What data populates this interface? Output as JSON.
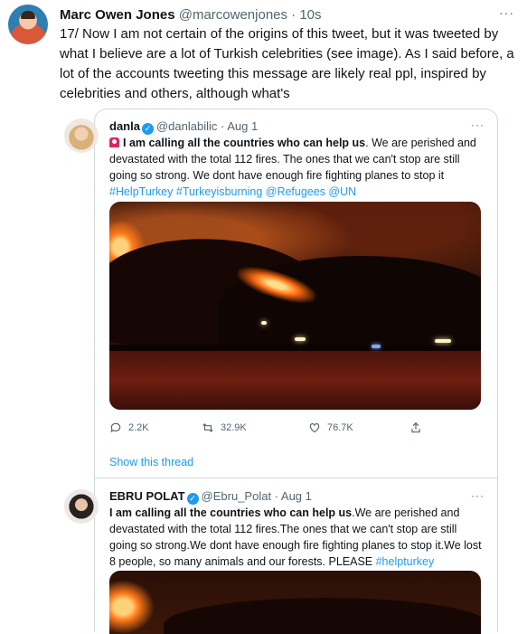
{
  "main_tweet": {
    "name": "Marc Owen Jones",
    "meta": "@marcowenjones · 10s",
    "more": "···",
    "text": "17/ Now I am not certain of the origins of this tweet, but it was tweeted by what I believe are a lot of Turkish celebrities (see image). As I said before, a lot of the accounts tweeting this message are likely real ppl, inspired by celebrities and others, although what's"
  },
  "quote1": {
    "name": "danla",
    "meta": "@danlabilic · Aug 1",
    "more": "···",
    "bold": "I am calling all the countries who can help us",
    "rest": ". We are perished and devastated with the total 112 fires. The ones that we can't stop are still going so strong. We dont have enough fire fighting planes to stop it",
    "tags": "#HelpTurkey #Turkeyisburning  @Refugees @UN",
    "replies": "2.2K",
    "retweets": "32.9K",
    "likes": "76.7K",
    "show_thread": "Show this thread"
  },
  "quote2": {
    "name": "EBRU POLAT",
    "meta": "@Ebru_Polat · Aug 1",
    "more": "···",
    "bold": "I am calling all the countries who can help us",
    "rest": ".We are perished and devastated with the total 112 fires.The ones that we can't stop are still going so strong.We dont have enough fire fighting planes to stop it.We lost 8 people, so many animals and our forests. PLEASE ",
    "tag": "#helpturkey"
  },
  "icons": [
    "reply-icon",
    "retweet-icon",
    "like-icon",
    "share-icon",
    "verified-icon",
    "siren-icon"
  ],
  "colors": {
    "link": "#1d9bf0",
    "muted": "#536471",
    "text": "#0f1419",
    "border": "#cfd9de"
  }
}
